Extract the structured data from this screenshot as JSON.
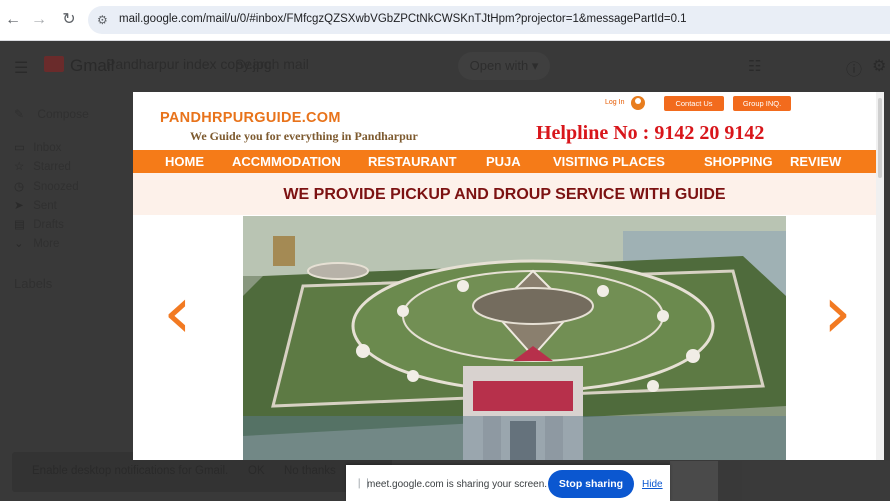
{
  "browser": {
    "url": "mail.google.com/mail/u/0/#inbox/FMfcgzQZSXwbVGbZPCtNkCWSKnTJtHpm?projector=1&messagePartId=0.1",
    "back_icon": "arrow-left-icon",
    "forward_icon": "arrow-right-icon",
    "reload_icon": "reload-icon",
    "site_info_icon": "tune-icon"
  },
  "gmail": {
    "logo_text": "Gmail",
    "attachment_name": "Pandharpur index copy.jpg",
    "search_placeholder": "Search mail",
    "open_with": "Open with",
    "compose": "Compose",
    "nav": [
      "Inbox",
      "Starred",
      "Snoozed",
      "Sent",
      "Drafts",
      "More"
    ],
    "labels_heading": "Labels",
    "notification": {
      "text": "Enable desktop notifications for Gmail.",
      "ok": "OK",
      "dismiss": "No thanks"
    }
  },
  "preview": {
    "site_title": "PANDHRPURGUIDE.COM",
    "tagline": "We Guide you for everything in Pandharpur",
    "login": "Log In",
    "contact_us": "Contact Us",
    "group_inq": "Group INQ.",
    "helpline": "Helpline No : 9142  20  9142",
    "menu": [
      "HOME",
      "ACCMMODATION",
      "RESTAURANT",
      "PUJA",
      "VISITING PLACES",
      "SHOPPING",
      "REVIEW"
    ],
    "banner": "WE PROVIDE PICKUP AND DROUP SERVICE WITH GUIDE",
    "prev_arrow": "‹",
    "next_arrow": "›",
    "accent_color": "#f57b18",
    "helpline_color": "#d8161b"
  },
  "share_bar": {
    "message": "meet.google.com is sharing your screen.",
    "stop_label": "Stop sharing",
    "hide_label": "Hide"
  }
}
